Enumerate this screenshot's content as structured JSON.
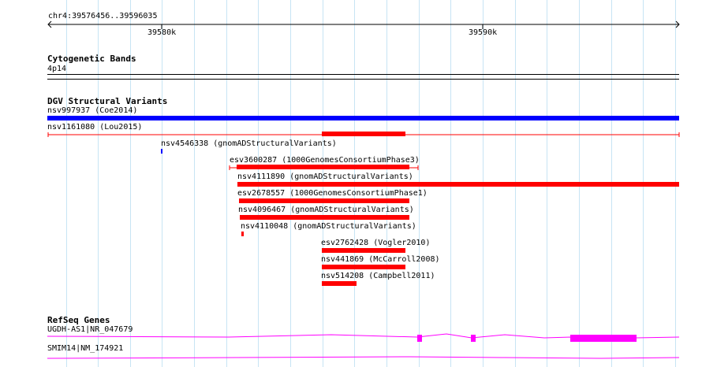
{
  "ruler": {
    "position_label": "chr4:39576456..39596035",
    "tick_labels": [
      "39580k",
      "39590k"
    ]
  },
  "tracks": {
    "cytogenetic": {
      "title": "Cytogenetic Bands",
      "band_label": "4p14"
    },
    "dgv": {
      "title": "DGV Structural Variants",
      "variants": [
        {
          "label": "nsv997937 (Coe2014)",
          "color": "#0000ff"
        },
        {
          "label": "nsv1161080 (Lou2015)",
          "color": "#ff0000"
        },
        {
          "label": "nsv4546338 (gnomADStructuralVariants)",
          "color": "#0000ff"
        },
        {
          "label": "esv3600287 (1000GenomesConsortiumPhase3)",
          "color": "#ff0000"
        },
        {
          "label": "nsv4111890 (gnomADStructuralVariants)",
          "color": "#ff0000"
        },
        {
          "label": "esv2678557 (1000GenomesConsortiumPhase1)",
          "color": "#ff0000"
        },
        {
          "label": "nsv4096467 (gnomADStructuralVariants)",
          "color": "#ff0000"
        },
        {
          "label": "nsv4110048 (gnomADStructuralVariants)",
          "color": "#ff0000"
        },
        {
          "label": "esv2762428 (Vogler2010)",
          "color": "#ff0000"
        },
        {
          "label": "nsv441869 (McCarroll2008)",
          "color": "#ff0000"
        },
        {
          "label": "nsv514208 (Campbell2011)",
          "color": "#ff0000"
        }
      ]
    },
    "refseq": {
      "title": "RefSeq Genes",
      "genes": [
        {
          "label": "UGDH-AS1|NR_047679",
          "color": "#ff00ff"
        },
        {
          "label": "SMIM14|NM_174921",
          "color": "#ff00ff"
        }
      ]
    }
  },
  "colors": {
    "grid": "#c7e4f4",
    "axis": "#000000",
    "gene": "#ff00ff"
  }
}
